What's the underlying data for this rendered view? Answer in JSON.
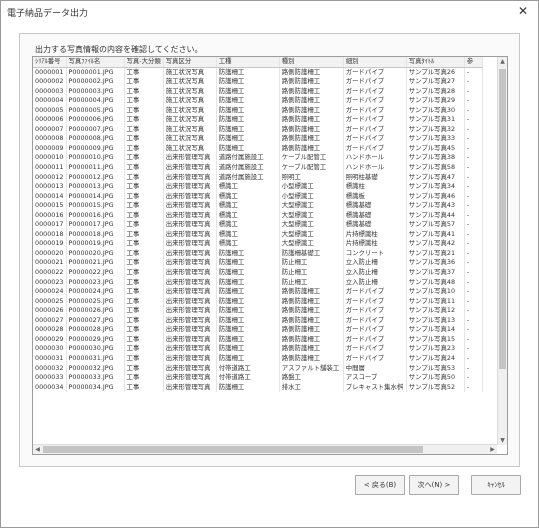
{
  "window": {
    "title": "電子納品データ出力"
  },
  "instruction": "出力する写真情報の内容を確認してください。",
  "columns": [
    "ｼﾘｱﾙ番号",
    "写真ﾌｧｲﾙ名",
    "写真-大分類",
    "写真区分",
    "工種",
    "種別",
    "細別",
    "写真ﾀｲﾄﾙ",
    "参"
  ],
  "rows": [
    [
      "0000001",
      "P0000001.JPG",
      "工事",
      "施工状況写真",
      "防護柵工",
      "路側防護柵工",
      "ガードパイプ",
      "サンプル写真26",
      "-"
    ],
    [
      "0000002",
      "P0000002.JPG",
      "工事",
      "施工状況写真",
      "防護柵工",
      "路側防護柵工",
      "ガードパイプ",
      "サンプル写真27",
      "-"
    ],
    [
      "0000003",
      "P0000003.JPG",
      "工事",
      "施工状況写真",
      "防護柵工",
      "路側防護柵工",
      "ガードパイプ",
      "サンプル写真28",
      "-"
    ],
    [
      "0000004",
      "P0000004.JPG",
      "工事",
      "施工状況写真",
      "防護柵工",
      "路側防護柵工",
      "ガードパイプ",
      "サンプル写真29",
      "-"
    ],
    [
      "0000005",
      "P0000005.JPG",
      "工事",
      "施工状況写真",
      "防護柵工",
      "路側防護柵工",
      "ガードパイプ",
      "サンプル写真30",
      "-"
    ],
    [
      "0000006",
      "P0000006.JPG",
      "工事",
      "施工状況写真",
      "防護柵工",
      "路側防護柵工",
      "ガードパイプ",
      "サンプル写真31",
      "-"
    ],
    [
      "0000007",
      "P0000007.JPG",
      "工事",
      "施工状況写真",
      "防護柵工",
      "路側防護柵工",
      "ガードパイプ",
      "サンプル写真32",
      "-"
    ],
    [
      "0000008",
      "P0000008.JPG",
      "工事",
      "施工状況写真",
      "防護柵工",
      "路側防護柵工",
      "ガードパイプ",
      "サンプル写真33",
      "-"
    ],
    [
      "0000009",
      "P0000009.JPG",
      "工事",
      "施工状況写真",
      "防護柵工",
      "路側防護柵工",
      "ガードパイプ",
      "サンプル写真45",
      "-"
    ],
    [
      "0000010",
      "P0000010.JPG",
      "工事",
      "出来形管理写真",
      "道路付属施設工",
      "ケーブル配管工",
      "ハンドホール",
      "サンプル写真38",
      "-"
    ],
    [
      "0000011",
      "P0000011.JPG",
      "工事",
      "出来形管理写真",
      "道路付属施設工",
      "ケーブル配管工",
      "ハンドホール",
      "サンプル写真58",
      "-"
    ],
    [
      "0000012",
      "P0000012.JPG",
      "工事",
      "出来形管理写真",
      "道路付属施設工",
      "照明工",
      "照明柱基礎",
      "サンプル写真47",
      "-"
    ],
    [
      "0000013",
      "P0000013.JPG",
      "工事",
      "出来形管理写真",
      "標識工",
      "小型標識工",
      "標識柱",
      "サンプル写真34",
      "-"
    ],
    [
      "0000014",
      "P0000014.JPG",
      "工事",
      "出来形管理写真",
      "標識工",
      "小型標識工",
      "標識板",
      "サンプル写真46",
      "-"
    ],
    [
      "0000015",
      "P0000015.JPG",
      "工事",
      "出来形管理写真",
      "標識工",
      "大型標識工",
      "標識基礎",
      "サンプル写真43",
      "-"
    ],
    [
      "0000016",
      "P0000016.JPG",
      "工事",
      "出来形管理写真",
      "標識工",
      "大型標識工",
      "標識基礎",
      "サンプル写真44",
      "-"
    ],
    [
      "0000017",
      "P0000017.JPG",
      "工事",
      "出来形管理写真",
      "標識工",
      "大型標識工",
      "標識基礎",
      "サンプル写真57",
      "-"
    ],
    [
      "0000018",
      "P0000018.JPG",
      "工事",
      "出来形管理写真",
      "標識工",
      "大型標識工",
      "片持標識柱",
      "サンプル写真41",
      "-"
    ],
    [
      "0000019",
      "P0000019.JPG",
      "工事",
      "出来形管理写真",
      "標識工",
      "大型標識工",
      "片持標識柱",
      "サンプル写真42",
      "-"
    ],
    [
      "0000020",
      "P0000020.JPG",
      "工事",
      "出来形管理写真",
      "防護柵工",
      "防護柵基礎工",
      "コンクリート",
      "サンプル写真21",
      "-"
    ],
    [
      "0000021",
      "P0000021.JPG",
      "工事",
      "出来形管理写真",
      "防護柵工",
      "防止柵工",
      "立入防止柵",
      "サンプル写真36",
      "-"
    ],
    [
      "0000022",
      "P0000022.JPG",
      "工事",
      "出来形管理写真",
      "防護柵工",
      "防止柵工",
      "立入防止柵",
      "サンプル写真37",
      "-"
    ],
    [
      "0000023",
      "P0000023.JPG",
      "工事",
      "出来形管理写真",
      "防護柵工",
      "防止柵工",
      "立入防止柵",
      "サンプル写真48",
      "-"
    ],
    [
      "0000024",
      "P0000024.JPG",
      "工事",
      "出来形管理写真",
      "防護柵工",
      "路側防護柵工",
      "ガードパイプ",
      "サンプル写真10",
      "-"
    ],
    [
      "0000025",
      "P0000025.JPG",
      "工事",
      "出来形管理写真",
      "防護柵工",
      "路側防護柵工",
      "ガードパイプ",
      "サンプル写真11",
      "-"
    ],
    [
      "0000026",
      "P0000026.JPG",
      "工事",
      "出来形管理写真",
      "防護柵工",
      "路側防護柵工",
      "ガードパイプ",
      "サンプル写真12",
      "-"
    ],
    [
      "0000027",
      "P0000027.JPG",
      "工事",
      "出来形管理写真",
      "防護柵工",
      "路側防護柵工",
      "ガードパイプ",
      "サンプル写真13",
      "-"
    ],
    [
      "0000028",
      "P0000028.JPG",
      "工事",
      "出来形管理写真",
      "防護柵工",
      "路側防護柵工",
      "ガードパイプ",
      "サンプル写真14",
      "-"
    ],
    [
      "0000029",
      "P0000029.JPG",
      "工事",
      "出来形管理写真",
      "防護柵工",
      "路側防護柵工",
      "ガードパイプ",
      "サンプル写真15",
      "-"
    ],
    [
      "0000030",
      "P0000030.JPG",
      "工事",
      "出来形管理写真",
      "防護柵工",
      "路側防護柵工",
      "ガードパイプ",
      "サンプル写真23",
      "-"
    ],
    [
      "0000031",
      "P0000031.JPG",
      "工事",
      "出来形管理写真",
      "防護柵工",
      "路側防護柵工",
      "ガードパイプ",
      "サンプル写真24",
      "-"
    ],
    [
      "0000032",
      "P0000032.JPG",
      "工事",
      "出来形管理写真",
      "付帯道路工",
      "アスファルト舗装工",
      "中間層",
      "サンプル写真53",
      "-"
    ],
    [
      "0000033",
      "P0000033.JPG",
      "工事",
      "出来形管理写真",
      "付帯道路工",
      "路盤工",
      "アスコーブ",
      "サンプル写真50",
      "-"
    ],
    [
      "0000034",
      "P0000034.JPG",
      "工事",
      "出来形管理写真",
      "防護柵工",
      "排水工",
      "プレキャスト集水桝",
      "サンプル写真52",
      "-"
    ]
  ],
  "buttons": {
    "back": "< 戻る(B)",
    "next": "次へ(N) >",
    "cancel": "ｷｬﾝｾﾙ"
  }
}
